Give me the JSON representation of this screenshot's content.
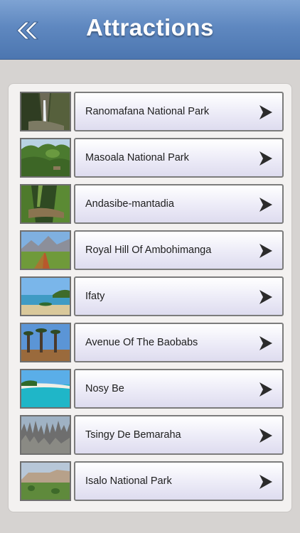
{
  "header": {
    "title": "Attractions",
    "back_icon": "double-chevron-left-icon"
  },
  "list": {
    "items": [
      {
        "label": "Ranomafana National Park",
        "thumb": "waterfall-gorge"
      },
      {
        "label": "Masoala National Park",
        "thumb": "rainforest"
      },
      {
        "label": "Andasibe-mantadia",
        "thumb": "jungle-stream"
      },
      {
        "label": "Royal Hill Of Ambohimanga",
        "thumb": "mountain-road"
      },
      {
        "label": "Ifaty",
        "thumb": "beach-boat"
      },
      {
        "label": "Avenue Of The Baobabs",
        "thumb": "baobab-avenue"
      },
      {
        "label": "Nosy Be",
        "thumb": "tropical-beach"
      },
      {
        "label": "Tsingy De Bemaraha",
        "thumb": "stone-pinnacles"
      },
      {
        "label": "Isalo National Park",
        "thumb": "canyon-plateau"
      }
    ],
    "chevron_icon": "chevron-right-icon"
  },
  "colors": {
    "header": "#5f88c0",
    "panel": "#f3f1f0",
    "button": "#ecebf7"
  }
}
